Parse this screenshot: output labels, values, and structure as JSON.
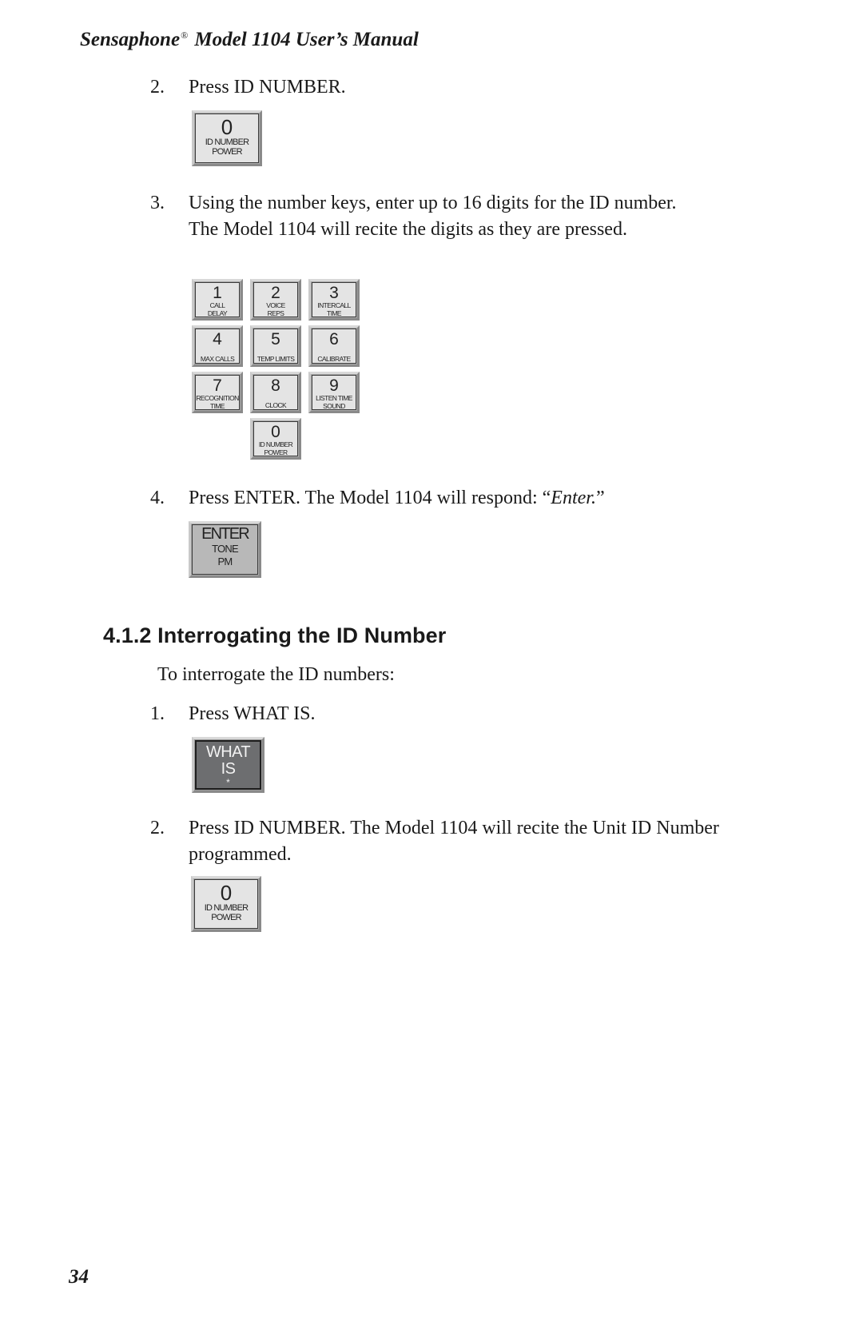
{
  "header": {
    "brand": "Sensaphone",
    "registered_mark": "®",
    "title_rest": "Model 1104 User’s Manual"
  },
  "steps_top": [
    {
      "number": "2.",
      "text": "Press ID NUMBER."
    },
    {
      "number": "3.",
      "text": "Using the number keys, enter up to 16 digits for the ID number. The Model 1104 will recite the digits as they are pressed."
    },
    {
      "number": "4.",
      "text_before": "Press ENTER. The Model 1104 will respond: “",
      "text_italic": "Enter.",
      "text_after": "”"
    }
  ],
  "keys": {
    "id_number": {
      "digit": "0",
      "line1": "ID NUMBER",
      "line2": "POWER"
    },
    "keypad": [
      {
        "digit": "1",
        "line1": "CALL",
        "line2": "DELAY"
      },
      {
        "digit": "2",
        "line1": "VOICE",
        "line2": "REPS"
      },
      {
        "digit": "3",
        "line1": "INTERCALL",
        "line2": "TIME"
      },
      {
        "digit": "4",
        "line1": "MAX CALLS",
        "line2": ""
      },
      {
        "digit": "5",
        "line1": "TEMP LIMITS",
        "line2": ""
      },
      {
        "digit": "6",
        "line1": "CALIBRATE",
        "line2": ""
      },
      {
        "digit": "7",
        "line1": "RECOGNITION",
        "line2": "TIME"
      },
      {
        "digit": "8",
        "line1": "CLOCK",
        "line2": ""
      },
      {
        "digit": "9",
        "line1": "LISTEN TIME",
        "line2": "SOUND"
      },
      {
        "digit": "0",
        "line1": "ID NUMBER",
        "line2": "POWER"
      }
    ],
    "enter": {
      "main": "ENTER",
      "line1": "TONE",
      "line2": "PM"
    },
    "what_is": {
      "line1": "WHAT",
      "line2": "IS",
      "symbol": "*"
    }
  },
  "section": {
    "heading": "4.1.2  Interrogating the ID Number",
    "intro": "To interrogate the ID numbers:",
    "steps": [
      {
        "number": "1.",
        "text": "Press WHAT IS."
      },
      {
        "number": "2.",
        "text": "Press ID NUMBER. The Model 1104 will recite the Unit ID Number programmed."
      }
    ]
  },
  "footer": {
    "page_number": "34"
  }
}
